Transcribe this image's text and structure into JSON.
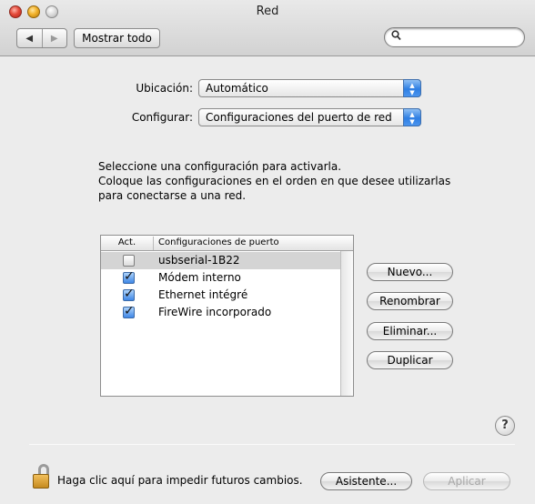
{
  "window": {
    "title": "Red"
  },
  "toolbar": {
    "back_glyph": "◀",
    "forward_glyph": "▶",
    "show_all_label": "Mostrar todo",
    "search_value": "",
    "search_icon": "magnifier-icon"
  },
  "location": {
    "label": "Ubicación:",
    "value": "Automático"
  },
  "configure": {
    "label": "Configurar:",
    "value": "Configuraciones del puerto de red"
  },
  "instructions": {
    "line1": "Seleccione una configuración para activarla.",
    "line2": "Coloque las configuraciones en el orden en que desee utilizarlas",
    "line3": "para conectarse a una red."
  },
  "table": {
    "col_active": "Act.",
    "col_config": "Configuraciones de puerto",
    "rows": [
      {
        "name": "usbserial-1B22",
        "active": false,
        "selected": true
      },
      {
        "name": "Módem interno",
        "active": true,
        "selected": false
      },
      {
        "name": "Ethernet intégré",
        "active": true,
        "selected": false
      },
      {
        "name": "FireWire incorporado",
        "active": true,
        "selected": false
      }
    ]
  },
  "buttons": {
    "new": "Nuevo...",
    "rename": "Renombrar",
    "delete": "Eliminar...",
    "duplicate": "Duplicar",
    "assistant": "Asistente...",
    "apply": "Aplicar"
  },
  "help": {
    "glyph": "?"
  },
  "footer": {
    "lock_text": "Haga clic aquí para impedir futuros cambios."
  },
  "colors": {
    "accent": "#3f87e6",
    "selected_row": "#d4d4d4",
    "window_bg": "#ececec"
  }
}
